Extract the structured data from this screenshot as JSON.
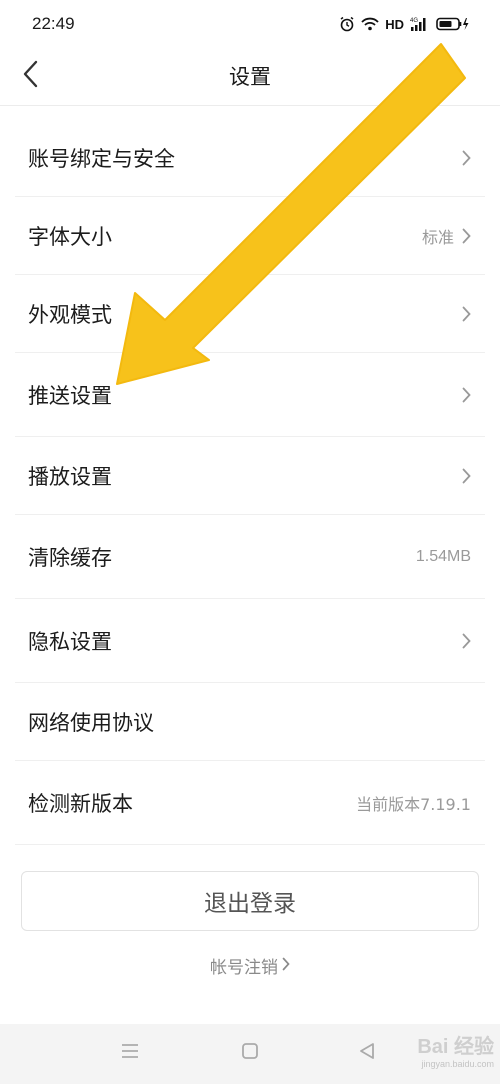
{
  "status_bar": {
    "time": "22:49",
    "network_label": "HD",
    "icons": [
      "alarm-icon",
      "wifi-icon",
      "signal-4g-icon",
      "battery-charging-icon"
    ]
  },
  "header": {
    "title": "设置",
    "back_icon": "chevron-left-icon"
  },
  "settings": {
    "items": [
      {
        "label": "账号绑定与安全",
        "value": "",
        "chevron": true
      },
      {
        "label": "字体大小",
        "value": "标准",
        "chevron": true
      },
      {
        "label": "外观模式",
        "value": "",
        "chevron": true
      },
      {
        "label": "推送设置",
        "value": "",
        "chevron": true
      },
      {
        "label": "播放设置",
        "value": "",
        "chevron": true
      },
      {
        "label": "清除缓存",
        "value": "1.54MB",
        "chevron": false
      },
      {
        "label": "隐私设置",
        "value": "",
        "chevron": true
      },
      {
        "label": "网络使用协议",
        "value": "",
        "chevron": false
      },
      {
        "label": "检测新版本",
        "value": "当前版本7.19.1",
        "chevron": false
      }
    ]
  },
  "actions": {
    "logout_label": "退出登录",
    "cancel_account_label": "帐号注销"
  },
  "system_nav": {
    "icons": [
      "menu-icon",
      "home-square-icon",
      "back-triangle-icon"
    ]
  },
  "watermark": {
    "text": "Bai 经验",
    "sub": "jingyan.baidu.com"
  },
  "colors": {
    "arrow": "#f7c21b",
    "divider": "#efefef",
    "secondary_text": "#9a9a9a"
  }
}
